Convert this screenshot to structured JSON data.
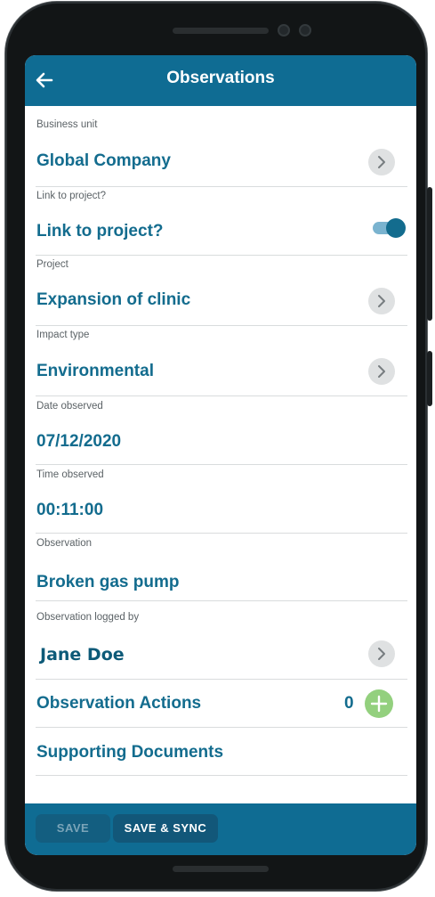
{
  "header": {
    "title": "Observations",
    "back_icon": "arrow-left-icon"
  },
  "fields": {
    "business_unit": {
      "label": "Business unit",
      "value": "Global Company"
    },
    "link_project": {
      "label": "Link to project?",
      "value": "Link to project?",
      "toggle_on": true
    },
    "project": {
      "label": "Project",
      "value": "Expansion of clinic"
    },
    "impact_type": {
      "label": "Impact type",
      "value": "Environmental"
    },
    "date_observed": {
      "label": "Date observed",
      "value": "07/12/2020"
    },
    "time_observed": {
      "label": "Time observed",
      "value": "00:11:00"
    },
    "observation": {
      "label": "Observation",
      "value": "Broken gas pump"
    },
    "logged_by": {
      "label": "Observation logged by",
      "value": "Jane Doe"
    }
  },
  "sections": {
    "actions": {
      "label": "Observation Actions",
      "count": "0"
    },
    "documents": {
      "label": "Supporting Documents"
    }
  },
  "footer": {
    "save_label": "SAVE",
    "sync_label": "SAVE & SYNC"
  },
  "colors": {
    "primary": "#0f6c93",
    "value_text": "#136c8e",
    "add_button": "#93d07e",
    "toggle_knob": "#136c8e"
  }
}
